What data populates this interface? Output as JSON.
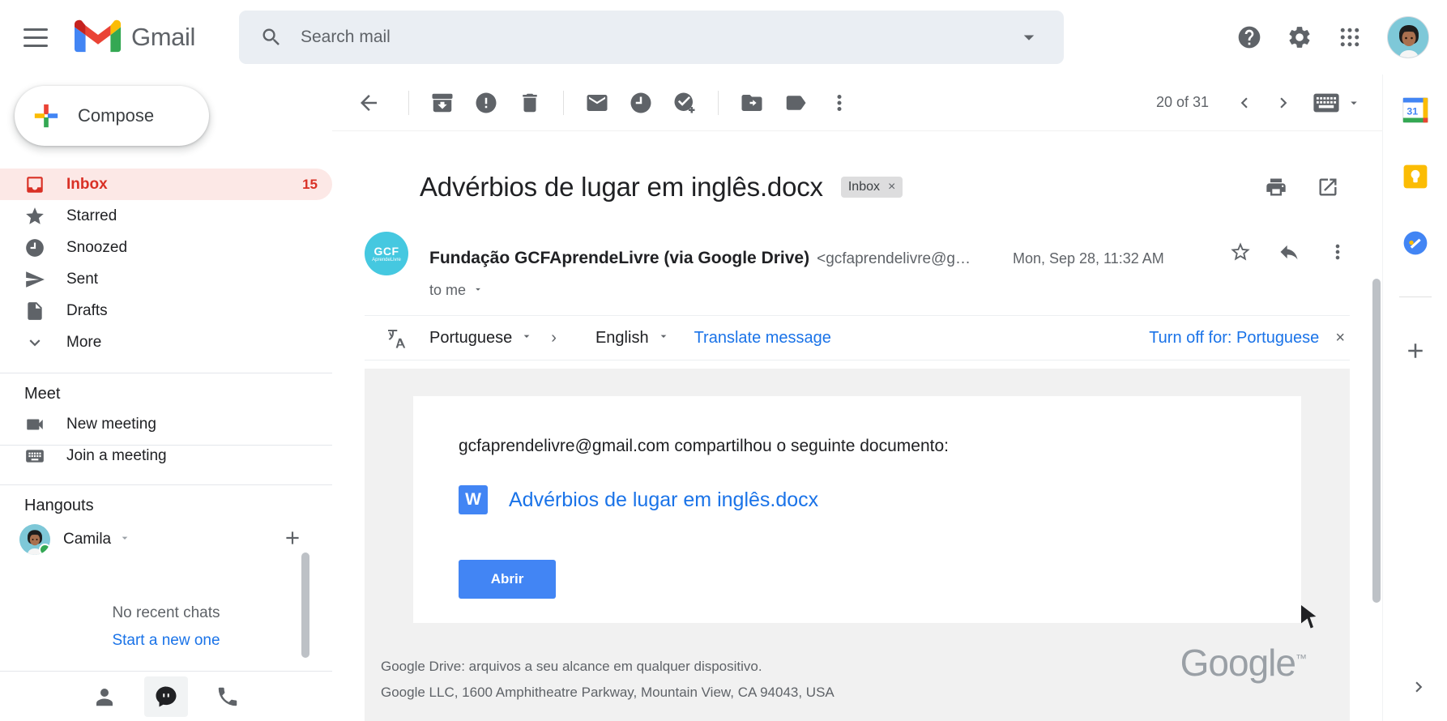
{
  "app": {
    "brand": "Gmail",
    "accent_red": "#d93025",
    "accent_blue": "#1a73e8",
    "button_blue": "#4285f4"
  },
  "topbar": {
    "menu_label": "Main menu",
    "search": {
      "placeholder": "Search mail",
      "value": ""
    },
    "help_label": "Support",
    "settings_label": "Settings",
    "apps_label": "Google apps",
    "account_label": "Google Account"
  },
  "sidebar": {
    "compose_label": "Compose",
    "items": [
      {
        "label": "Inbox",
        "count": "15",
        "icon": "inbox-icon",
        "active": true
      },
      {
        "label": "Starred",
        "count": "",
        "icon": "star-icon",
        "active": false
      },
      {
        "label": "Snoozed",
        "count": "",
        "icon": "clock-icon",
        "active": false
      },
      {
        "label": "Sent",
        "count": "",
        "icon": "send-icon",
        "active": false
      },
      {
        "label": "Drafts",
        "count": "",
        "icon": "draft-icon",
        "active": false
      },
      {
        "label": "More",
        "count": "",
        "icon": "chevron-down-icon",
        "active": false
      }
    ],
    "meet": {
      "title": "Meet",
      "items": [
        {
          "label": "New meeting",
          "icon": "video-camera-icon"
        },
        {
          "label": "Join a meeting",
          "icon": "keyboard-icon"
        }
      ]
    },
    "hangouts": {
      "title": "Hangouts",
      "user_name": "Camila",
      "status": "online",
      "empty_text": "No recent chats",
      "start_link": "Start a new one"
    },
    "chat_tabs": [
      {
        "name": "contacts-tab",
        "icon": "person-icon",
        "selected": false
      },
      {
        "name": "conversations-tab",
        "icon": "chat-icon",
        "selected": true
      },
      {
        "name": "calls-tab",
        "icon": "phone-icon",
        "selected": false
      }
    ]
  },
  "toolbar": {
    "back_label": "Back to Inbox",
    "archive_label": "Archive",
    "spam_label": "Report spam",
    "delete_label": "Delete",
    "unread_label": "Mark as unread",
    "snooze_label": "Snooze",
    "tasks_label": "Add to Tasks",
    "moveto_label": "Move to",
    "labels_label": "Labels",
    "more_label": "More",
    "pager_count": "20 of 31",
    "prev_label": "Older",
    "next_label": "Newer",
    "keyboard_label": "Input tools"
  },
  "email": {
    "subject": "Advérbios de lugar em inglês.docx",
    "label_chip": "Inbox",
    "chip_close": "×",
    "print_label": "Print all",
    "popout_label": "Open in new window",
    "sender_name": "Fundação GCFAprendeLivre (via Google Drive)",
    "sender_email": "<gcfaprendelivre@g…",
    "sender_avatar_text": "GCF",
    "sender_avatar_sub": "AprendeLivre",
    "date": "Mon, Sep 28, 11:32 AM",
    "to_line": "to me",
    "star_label": "Not starred",
    "reply_label": "Reply",
    "more_label": "More options",
    "translate": {
      "source_lang": "Portuguese",
      "arrow": "›",
      "target_lang": "English",
      "action": "Translate message",
      "turn_off": "Turn off for: Portuguese",
      "close": "×"
    },
    "body": {
      "intro": "gcfaprendelivre@gmail.com compartilhou o seguinte documento:",
      "attachment_icon_letter": "W",
      "attachment_name": "Advérbios de lugar em inglês.docx",
      "open_button": "Abrir",
      "footer_line1": "Google Drive: arquivos a seu alcance em qualquer dispositivo.",
      "footer_line2": "Google LLC, 1600 Amphitheatre Parkway, Mountain View, CA 94043, USA",
      "watermark": "Google",
      "watermark_tm": "™"
    }
  },
  "rail": {
    "items": [
      {
        "name": "google-calendar-icon",
        "label": "Calendar",
        "badge": "31"
      },
      {
        "name": "google-keep-icon",
        "label": "Keep",
        "badge": ""
      },
      {
        "name": "google-tasks-icon",
        "label": "Tasks",
        "badge": ""
      }
    ],
    "add_label": "Get add-ons",
    "expand_label": "Show side panel"
  }
}
